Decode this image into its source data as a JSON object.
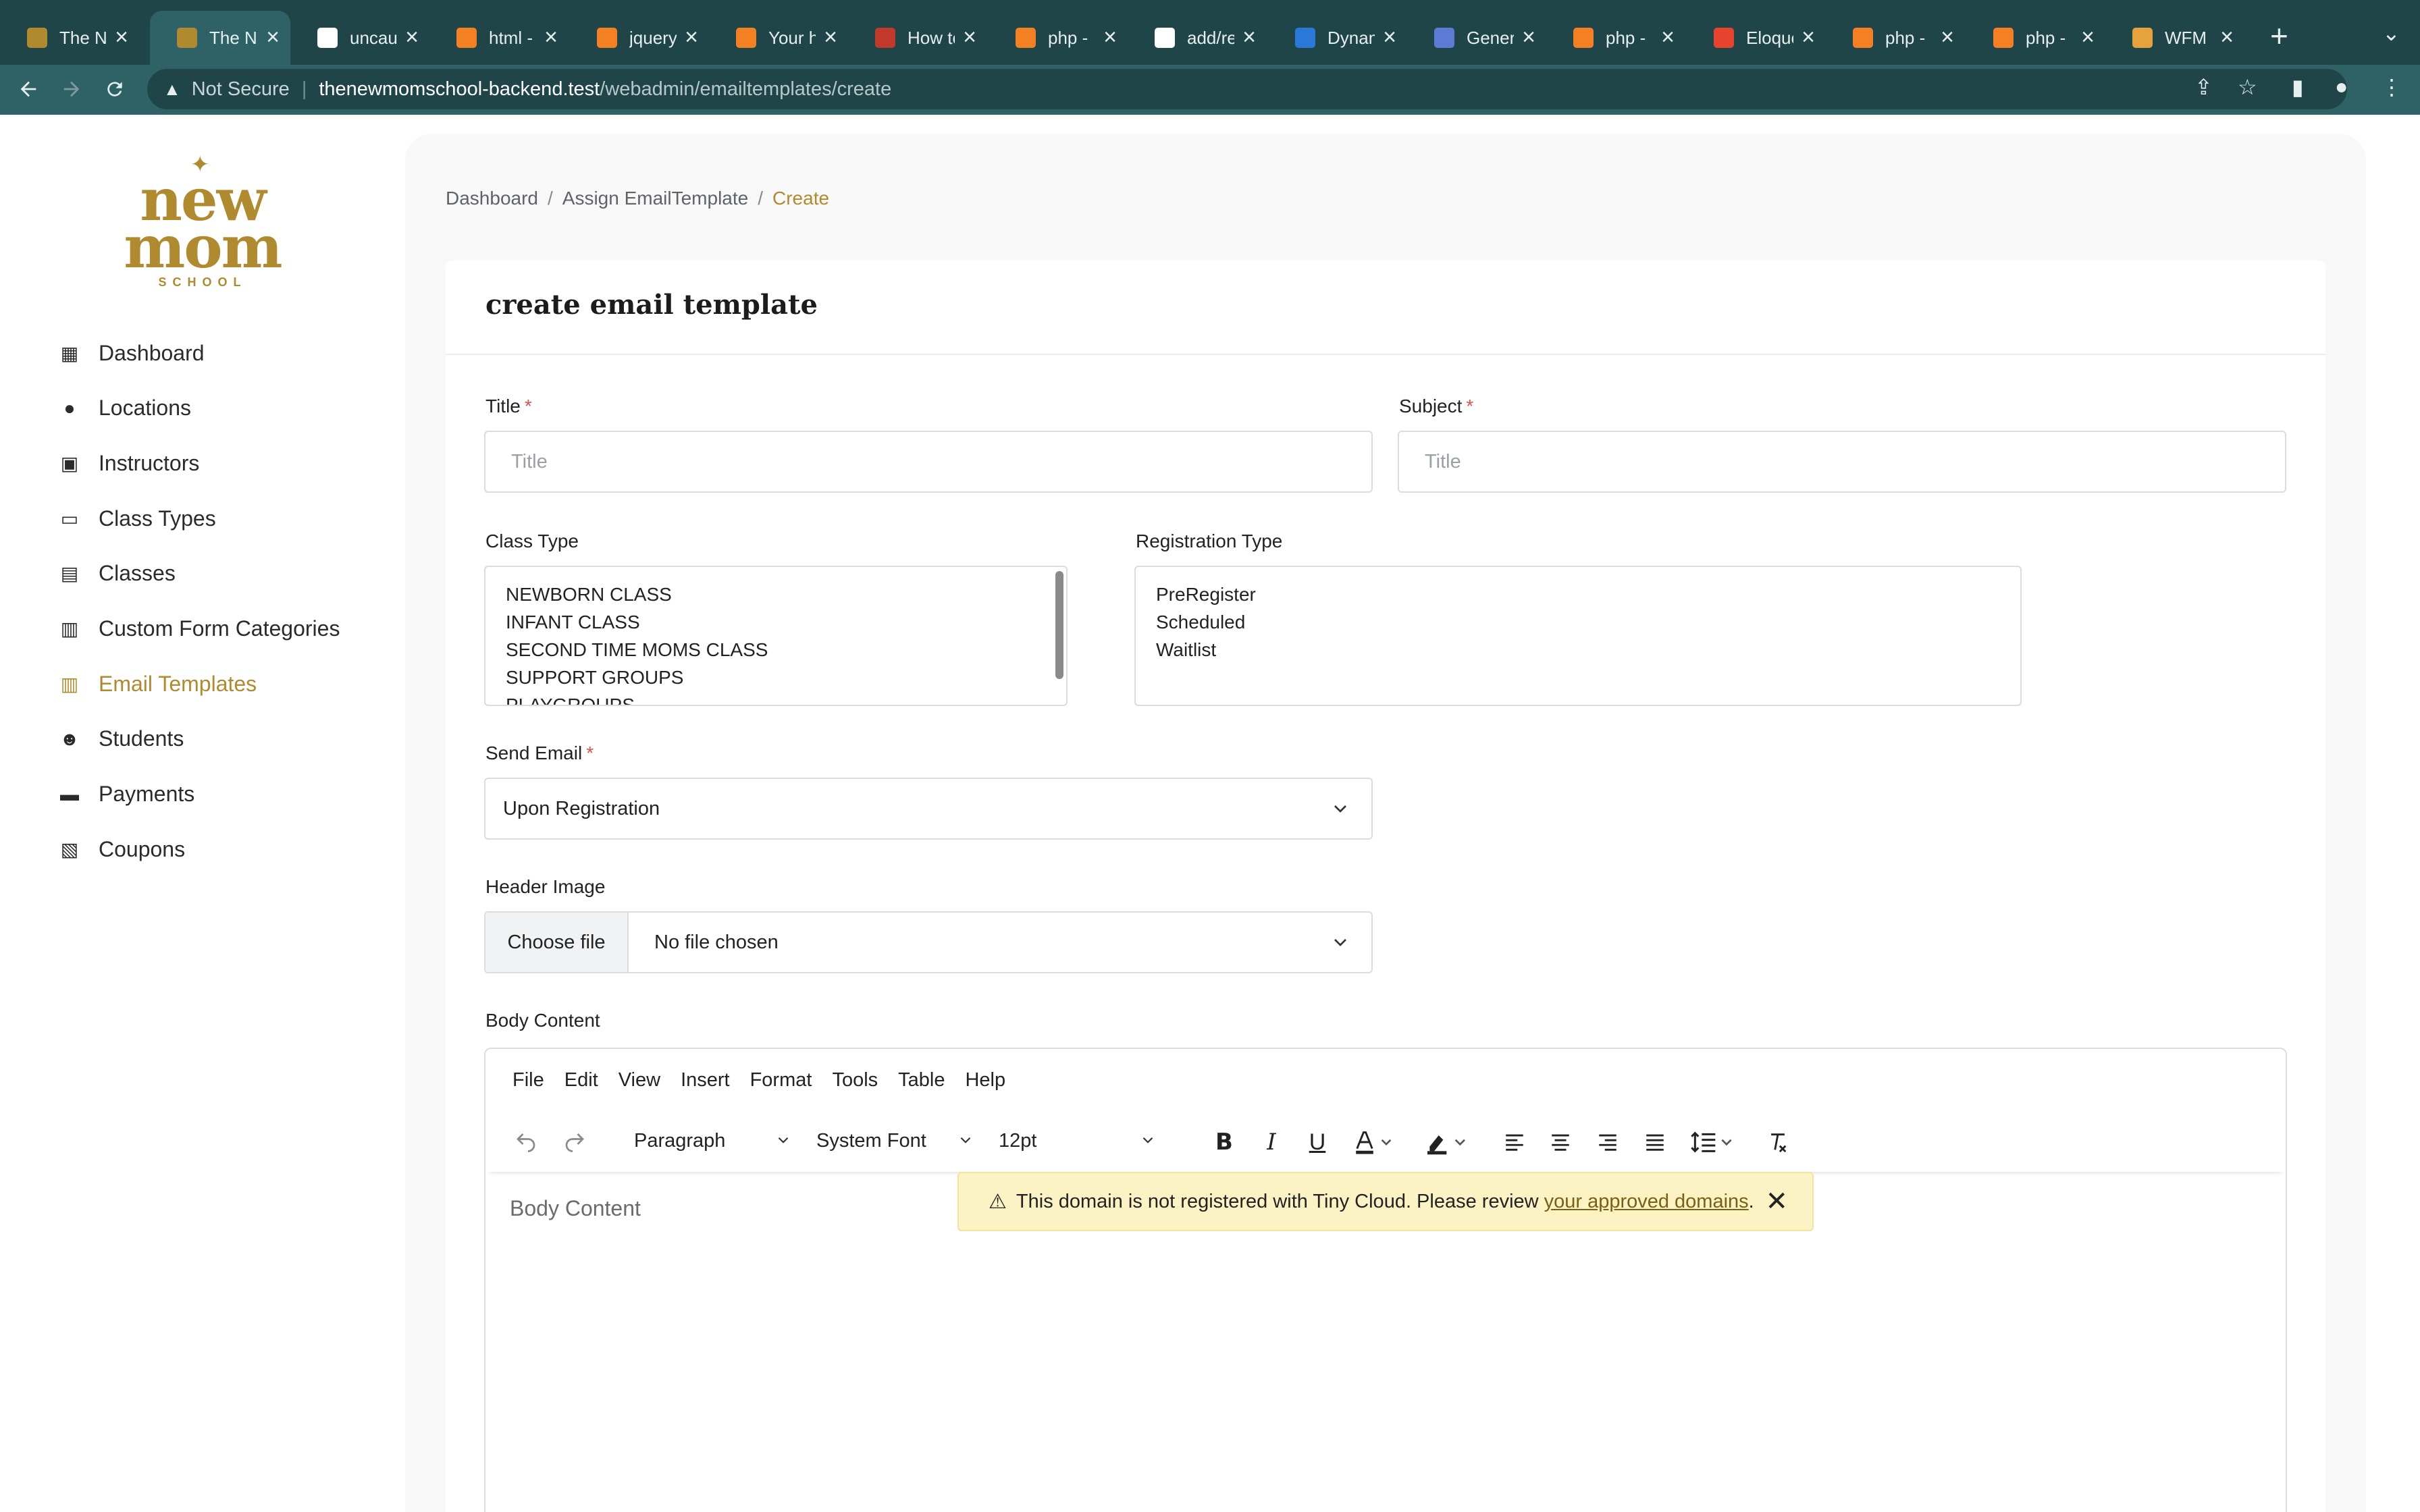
{
  "browser": {
    "tabs": [
      {
        "title": "The Ne",
        "favicon": "newmom-favicon",
        "color": "#b08a2e"
      },
      {
        "title": "The Ne",
        "favicon": "newmom-favicon",
        "color": "#b08a2e",
        "active": true
      },
      {
        "title": "uncau",
        "favicon": "google-favicon",
        "color": "#ffffff"
      },
      {
        "title": "html -",
        "favicon": "stackoverflow-favicon",
        "color": "#f48024"
      },
      {
        "title": "jquery",
        "favicon": "stackoverflow-favicon",
        "color": "#f48024"
      },
      {
        "title": "Your h",
        "favicon": "stackoverflow-favicon",
        "color": "#f48024"
      },
      {
        "title": "How to",
        "favicon": "w3schools-favicon",
        "color": "#c0392b"
      },
      {
        "title": "php -",
        "favicon": "stackoverflow-favicon",
        "color": "#f48024"
      },
      {
        "title": "add/re",
        "favicon": "paper-plane-favicon",
        "color": "#ffffff"
      },
      {
        "title": "Dynam",
        "favicon": "m-favicon",
        "color": "#2a79d8"
      },
      {
        "title": "Gener",
        "favicon": "code-favicon",
        "color": "#5b7bd5"
      },
      {
        "title": "php -",
        "favicon": "stackoverflow-favicon",
        "color": "#f48024"
      },
      {
        "title": "Eloque",
        "favicon": "laravel-favicon",
        "color": "#e74430"
      },
      {
        "title": "php -",
        "favicon": "stackoverflow-favicon",
        "color": "#f48024"
      },
      {
        "title": "php -",
        "favicon": "stackoverflow-favicon",
        "color": "#f48024"
      },
      {
        "title": "WFM",
        "favicon": "wfm-favicon",
        "color": "#e6a23c"
      }
    ],
    "security_label": "Not Secure",
    "url_host": "thenewmomschool-backend.test",
    "url_path": "/webadmin/emailtemplates/create"
  },
  "logo": {
    "line1": "new",
    "line2": "mom",
    "line3": "SCHOOL"
  },
  "sidebar": {
    "items": [
      {
        "label": "Dashboard",
        "icon": "dashboard-icon"
      },
      {
        "label": "Locations",
        "icon": "map-pin-icon"
      },
      {
        "label": "Instructors",
        "icon": "chalkboard-teacher-icon"
      },
      {
        "label": "Class Types",
        "icon": "laptop-icon"
      },
      {
        "label": "Classes",
        "icon": "book-icon"
      },
      {
        "label": "Custom Form Categories",
        "icon": "file-icon"
      },
      {
        "label": "Email Templates",
        "icon": "file-text-icon",
        "active": true
      },
      {
        "label": "Students",
        "icon": "users-icon"
      },
      {
        "label": "Payments",
        "icon": "credit-card-icon"
      },
      {
        "label": "Coupons",
        "icon": "gift-icon"
      }
    ]
  },
  "breadcrumb": {
    "items": [
      "Dashboard",
      "Assign EmailTemplate",
      "Create"
    ],
    "separator": "/"
  },
  "form": {
    "heading": "create email template",
    "title_label": "Title",
    "title_placeholder": "Title",
    "subject_label": "Subject",
    "subject_placeholder": "Title",
    "required_mark": "*",
    "class_type_label": "Class Type",
    "class_type_options": [
      "NEWBORN CLASS",
      "INFANT CLASS",
      "SECOND TIME MOMS CLASS",
      "SUPPORT GROUPS",
      "PLAYGROUPS"
    ],
    "registration_type_label": "Registration Type",
    "registration_type_options": [
      "PreRegister",
      "Scheduled",
      "Waitlist"
    ],
    "send_email_label": "Send Email",
    "send_email_value": "Upon Registration",
    "header_image_label": "Header Image",
    "choose_file_label": "Choose file",
    "no_file_text": "No file chosen",
    "body_content_label": "Body Content"
  },
  "editor": {
    "menu": [
      "File",
      "Edit",
      "View",
      "Insert",
      "Format",
      "Tools",
      "Table",
      "Help"
    ],
    "block_format": "Paragraph",
    "font_family": "System Font",
    "font_size": "12pt",
    "placeholder": "Body Content",
    "notice_text": "This domain is not registered with Tiny Cloud. Please review",
    "notice_link": "your approved domains",
    "notice_end": "."
  },
  "colors": {
    "accent": "#b08a2e",
    "chrome": "#1f4548",
    "chrome_active": "#2e6266"
  }
}
